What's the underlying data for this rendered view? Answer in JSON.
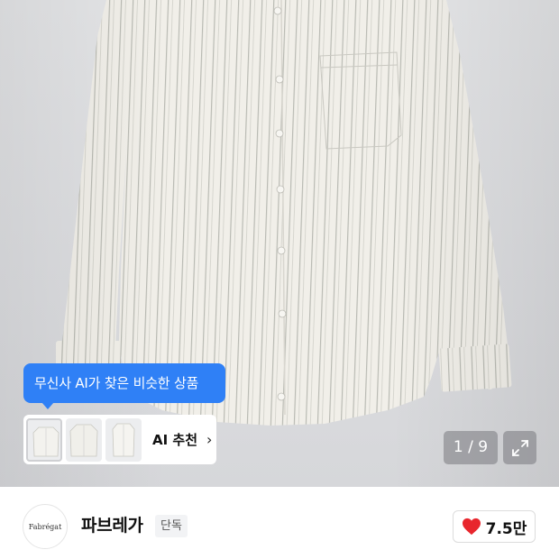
{
  "product_image": {
    "counter": "1 / 9",
    "expand_icon": "expand-icon",
    "colors": {
      "shirt": "#f1efe9",
      "stripe": "#8a8d86",
      "background": "#dedfe1"
    }
  },
  "ai_recommend": {
    "tooltip": "무신사 AI가 찾은 비슷한 상품",
    "label": "AI 추천",
    "chevron_icon": "chevron-right-icon",
    "thumbnail_count": 3,
    "accent_color": "#2f80f6"
  },
  "brand": {
    "logo_text": "Fabrégat",
    "name": "파브레가",
    "badge": "단독"
  },
  "like": {
    "icon": "heart-icon",
    "count": "7.5만",
    "color": "#e8262d"
  }
}
